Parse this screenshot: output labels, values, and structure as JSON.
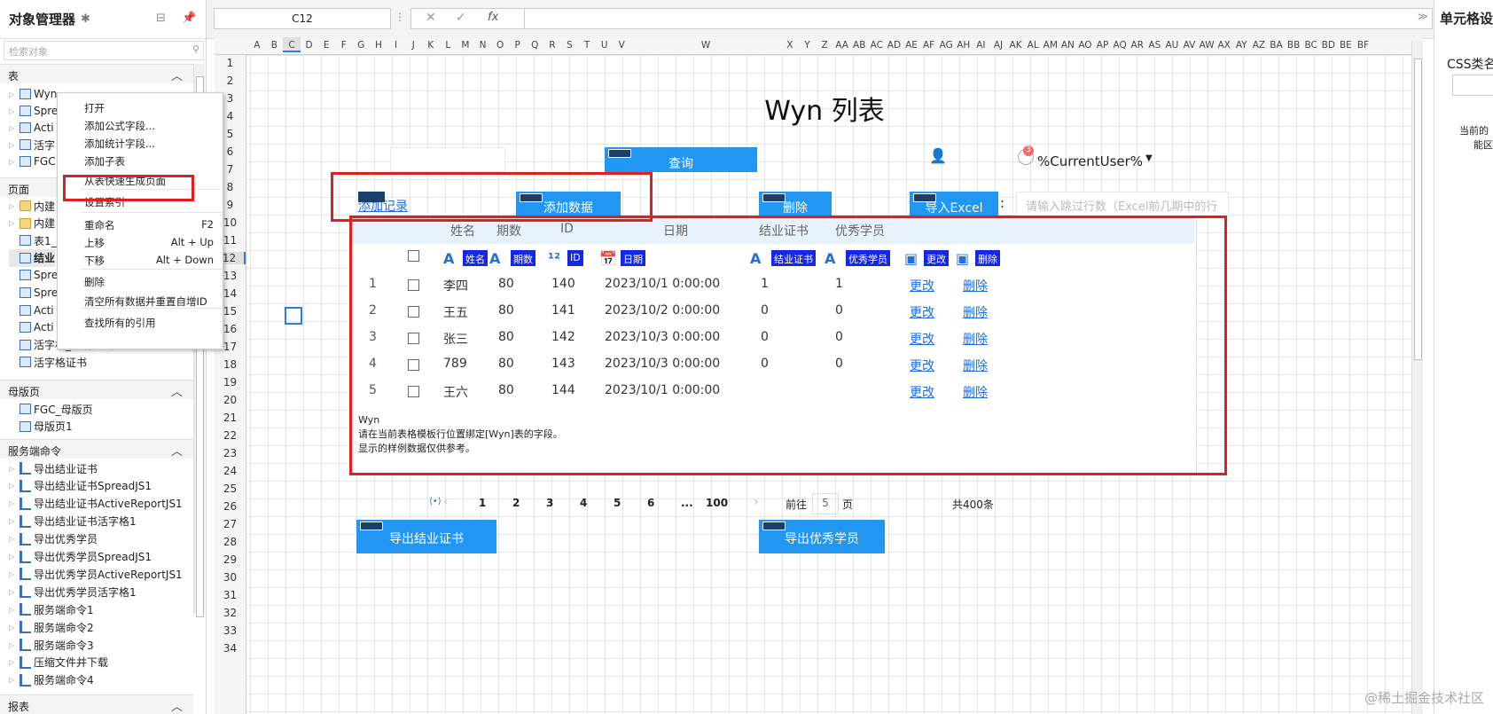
{
  "left_panel": {
    "title": "对象管理器",
    "search_placeholder": "检索对象",
    "sections": {
      "tables": "表",
      "pages": "页面",
      "master_pages": "母版页",
      "server_commands": "服务端命令",
      "reports": "报表"
    },
    "tables": [
      "Wyn",
      "Spre",
      "Acti",
      "活字",
      "FGC"
    ],
    "pages": [
      "内建",
      "内建",
      "表1_",
      "结业",
      "Spre",
      "Spre",
      "Acti",
      "Acti",
      "活字格_详情页面",
      "活字格证书"
    ],
    "master_pages": [
      "FGC_母版页",
      "母版页1"
    ],
    "server_commands": [
      "导出结业证书",
      "导出结业证书SpreadJS1",
      "导出结业证书ActiveReportJS1",
      "导出结业证书活字格1",
      "导出优秀学员",
      "导出优秀学员SpreadJS1",
      "导出优秀学员ActiveReportJS1",
      "导出优秀学员活字格1",
      "服务端命令1",
      "服务端命令2",
      "服务端命令3",
      "压缩文件并下载",
      "服务端命令4"
    ]
  },
  "context_menu": {
    "items": [
      {
        "label": "打开",
        "key": ""
      },
      {
        "label": "添加公式字段...",
        "key": ""
      },
      {
        "label": "添加统计字段...",
        "key": ""
      },
      {
        "label": "添加子表",
        "key": ""
      },
      {
        "label": "从表快速生成页面",
        "key": ""
      },
      {
        "label": "设置索引",
        "key": ""
      },
      {
        "label": "重命名",
        "key": "F2"
      },
      {
        "label": "上移",
        "key": "Alt + Up"
      },
      {
        "label": "下移",
        "key": "Alt + Down"
      },
      {
        "label": "删除",
        "key": ""
      },
      {
        "label": "清空所有数据并重置自增ID",
        "key": ""
      },
      {
        "label": "查找所有的引用",
        "key": ""
      }
    ]
  },
  "toolbar": {
    "cell_ref": "C12",
    "fx": "fx"
  },
  "right_panel": {
    "title": "单元格设",
    "css_label": "CSS类名",
    "note1": "当前的",
    "note2": "能区"
  },
  "grid": {
    "columns": [
      "A",
      "B",
      "C",
      "D",
      "E",
      "F",
      "G",
      "H",
      "I",
      "J",
      "K",
      "L",
      "M",
      "N",
      "O",
      "P",
      "Q",
      "R",
      "S",
      "T",
      "U",
      "V",
      "W",
      "X",
      "Y",
      "Z",
      "AA",
      "AB",
      "AC",
      "AD",
      "AE",
      "AF",
      "AG",
      "AH",
      "AI",
      "AJ",
      "AK",
      "AL",
      "AM",
      "AN",
      "AO",
      "AP",
      "AQ",
      "AR",
      "AS",
      "AU",
      "AV",
      "AW",
      "AX",
      "AY",
      "AZ",
      "BA",
      "BB",
      "BC",
      "BD",
      "BE",
      "BF"
    ],
    "selected_column": "C",
    "rows": [
      "1",
      "2",
      "3",
      "4",
      "5",
      "6",
      "7",
      "8",
      "9",
      "10",
      "11",
      "12",
      "13",
      "14",
      "15",
      "16",
      "17",
      "18",
      "19",
      "20",
      "21",
      "22",
      "23",
      "24",
      "25",
      "26",
      "27",
      "28",
      "29",
      "30",
      "31",
      "32",
      "33",
      "34"
    ],
    "selected_row": "12"
  },
  "page": {
    "title": "Wyn 列表",
    "query_button": "查询",
    "current_user": "%CurrentUser%",
    "user_badge": "3",
    "add_record_link": "添加记录",
    "add_data_button": "添加数据",
    "delete_button": "删除",
    "import_button": "导入Excel",
    "import_colon": ":",
    "skip_rows_placeholder": "请输入跳过行数（Excel前几期中的行",
    "export_cert_button": "导出结业证书",
    "export_excellent_button": "导出优秀学员"
  },
  "table": {
    "headers": [
      "姓名",
      "期数",
      "ID",
      "日期",
      "结业证书",
      "优秀学员"
    ],
    "field_tags": [
      "姓名",
      "期数",
      "ID",
      "日期",
      "结业证书",
      "优秀学员",
      "更改",
      "删除"
    ],
    "rows": [
      {
        "n": "1",
        "name": "李四",
        "period": "80",
        "id": "140",
        "date": "2023/10/1 0:00:00",
        "cert": "1",
        "excellent": "1"
      },
      {
        "n": "2",
        "name": "王五",
        "period": "80",
        "id": "141",
        "date": "2023/10/2 0:00:00",
        "cert": "0",
        "excellent": "0"
      },
      {
        "n": "3",
        "name": "张三",
        "period": "80",
        "id": "142",
        "date": "2023/10/3 0:00:00",
        "cert": "0",
        "excellent": "0"
      },
      {
        "n": "4",
        "name": "789",
        "period": "80",
        "id": "143",
        "date": "2023/10/3 0:00:00",
        "cert": "0",
        "excellent": "0"
      },
      {
        "n": "5",
        "name": "王六",
        "period": "80",
        "id": "144",
        "date": "2023/10/1 0:00:00",
        "cert": "",
        "excellent": ""
      }
    ],
    "edit_label": "更改",
    "delete_label": "删除",
    "note": [
      "Wyn",
      "请在当前表格模板行位置绑定[Wyn]表的字段。",
      "显示的样例数据仅供参考。"
    ]
  },
  "pager": {
    "pages": [
      "1",
      "2",
      "3",
      "4",
      "5",
      "6",
      "...",
      "100"
    ],
    "goto_label": "前往",
    "goto_value": "5",
    "page_unit": "页",
    "total": "共400条"
  },
  "watermark": "@稀土掘金技术社区"
}
